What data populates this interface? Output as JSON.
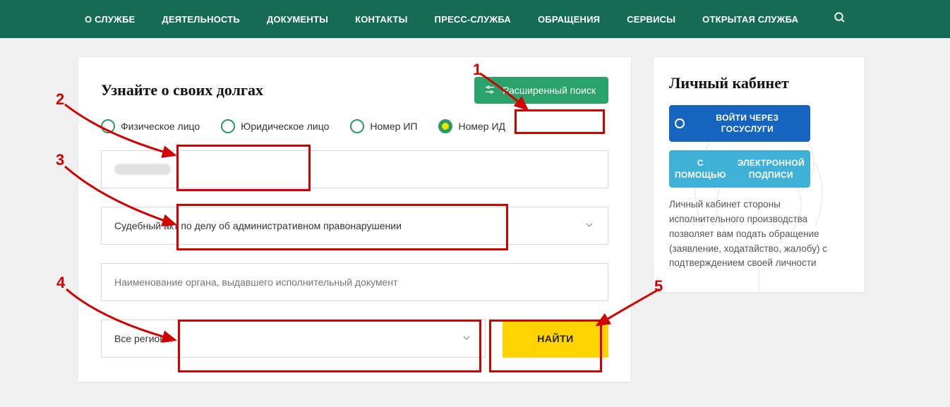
{
  "nav": {
    "items": [
      "О СЛУЖБЕ",
      "ДЕЯТЕЛЬНОСТЬ",
      "ДОКУМЕНТЫ",
      "КОНТАКТЫ",
      "ПРЕСС-СЛУЖБА",
      "ОБРАЩЕНИЯ",
      "СЕРВИСЫ",
      "ОТКРЫТАЯ СЛУЖБА"
    ]
  },
  "search": {
    "title": "Узнайте о своих долгах",
    "advanced_label": "Расширенный поиск",
    "radios": {
      "r1": "Физическое лицо",
      "r2": "Юридическое лицо",
      "r3": "Номер ИП",
      "r4": "Номер ИД"
    },
    "selected_radio": "r4",
    "number_value": "",
    "doc_type_value": "Судебный акт по делу об административном правонарушении",
    "issuer_placeholder": "Наименование органа, выдавшего исполнительный документ",
    "region_value": "Все регионы",
    "find_label": "НАЙТИ"
  },
  "sidebar": {
    "title": "Личный кабинет",
    "login_gosuslugi": "ВОЙТИ ЧЕРЕЗ ГОСУСЛУГИ",
    "login_ep_line1": "С ПОМОЩЬЮ",
    "login_ep_line2": "ЭЛЕКТРОННОЙ ПОДПИСИ",
    "description": "Личный кабинет стороны исполнительного производства позволяет вам подать обращение (заявление, ходатайство, жалобу) с подтверждением своей личности"
  },
  "annotations": {
    "n1": "1",
    "n2": "2",
    "n3": "3",
    "n4": "4",
    "n5": "5"
  }
}
